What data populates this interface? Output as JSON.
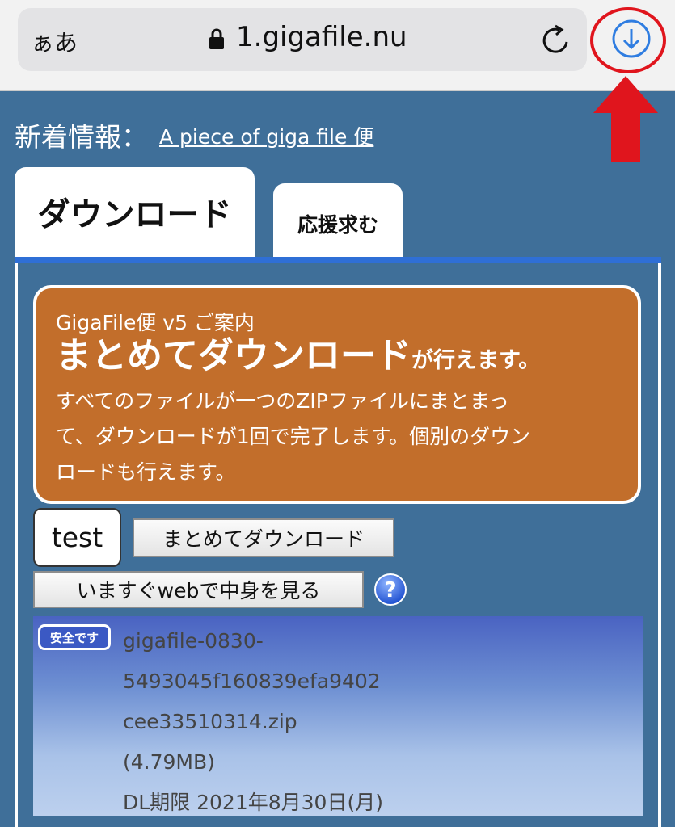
{
  "browser": {
    "text_size_label": "ぁあ",
    "url": "1.gigafile.nu"
  },
  "news": {
    "label": "新着情報：",
    "link": "A piece of giga file 便"
  },
  "tabs": [
    {
      "label": "ダウンロード",
      "active": true
    },
    {
      "label": "応援求む",
      "active": false
    }
  ],
  "info_box": {
    "subtitle": "GigaFile便 v5 ご案内",
    "headline": "まとめてダウンロード",
    "headline_suffix": "が行えます。",
    "line1": "すべてのファイルが一つのZIPファイルにまとまっ",
    "line2": "て、ダウンロードが1回で完了します。個別のダウン",
    "line3": "ロードも行えます。"
  },
  "file_tab": "test",
  "buttons": {
    "bulk_download": "まとめてダウンロード",
    "view_web": "いますぐwebで中身を見る"
  },
  "file": {
    "safe_badge": "安全です",
    "name_line1": "gigafile-0830-",
    "name_line2": "5493045f160839efa9402",
    "name_line3": "cee33510314.zip",
    "size": "(4.79MB)",
    "deadline": "DL期限 2021年8月30日(月)"
  },
  "colors": {
    "page_bg": "#3f6f99",
    "info_bg": "#c26e2b",
    "tab_underline": "#2f6fd6",
    "annotation_red": "#e0151d",
    "download_icon": "#2f7de1"
  }
}
